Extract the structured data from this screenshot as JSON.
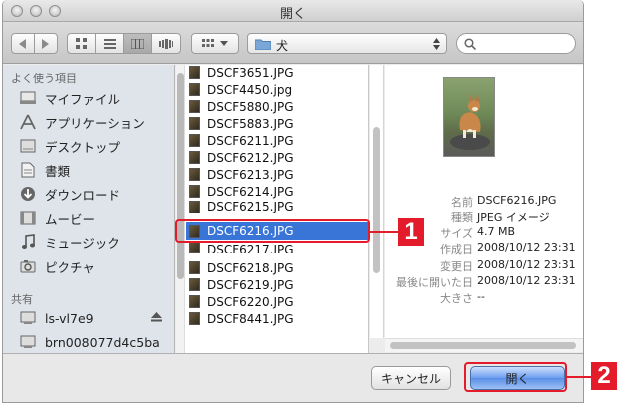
{
  "window": {
    "title": "開く"
  },
  "toolbar": {
    "back_icon": "back-chevron-icon",
    "forward_icon": "forward-chevron-icon",
    "location": "犬"
  },
  "sidebar": {
    "favorites_header": "よく使う項目",
    "favorites": [
      {
        "label": "マイファイル",
        "icon": "all-my-files-icon"
      },
      {
        "label": "アプリケーション",
        "icon": "applications-icon"
      },
      {
        "label": "デスクトップ",
        "icon": "desktop-icon"
      },
      {
        "label": "書類",
        "icon": "documents-icon"
      },
      {
        "label": "ダウンロード",
        "icon": "downloads-icon"
      },
      {
        "label": "ムービー",
        "icon": "movies-icon"
      },
      {
        "label": "ミュージック",
        "icon": "music-icon"
      },
      {
        "label": "ピクチャ",
        "icon": "pictures-icon"
      }
    ],
    "shared_header": "共有",
    "shared": [
      {
        "label": "ls-vl7e9",
        "icon": "network-computer-icon"
      },
      {
        "label": "brn008077d4c5ba",
        "icon": "network-computer-icon"
      }
    ]
  },
  "files": [
    "DSCF3651.JPG",
    "DSCF4450.jpg",
    "DSCF5880.JPG",
    "DSCF5883.JPG",
    "DSCF6211.JPG",
    "DSCF6212.JPG",
    "DSCF6213.JPG",
    "DSCF6214.JPG",
    "DSCF6215.JPG",
    "DSCF6216.JPG",
    "DSCF6217.JPG",
    "DSCF6218.JPG",
    "DSCF6219.JPG",
    "DSCF6220.JPG",
    "DSCF8441.JPG"
  ],
  "selected_file_index": 9,
  "preview": {
    "rows": [
      {
        "label": "名前",
        "value": "DSCF6216.JPG"
      },
      {
        "label": "種類",
        "value": "JPEG イメージ"
      },
      {
        "label": "サイズ",
        "value": "4.7 MB"
      },
      {
        "label": "作成日",
        "value": "2008/10/12 23:31"
      },
      {
        "label": "変更日",
        "value": "2008/10/12 23:31"
      },
      {
        "label": "最後に開いた日",
        "value": "2008/10/12 23:31"
      },
      {
        "label": "大きさ",
        "value": "--"
      }
    ]
  },
  "buttons": {
    "cancel": "キャンセル",
    "open": "開く"
  },
  "callouts": {
    "one": "1",
    "two": "2"
  },
  "colors": {
    "selection": "#3875d7",
    "callout": "#e41b2b"
  }
}
